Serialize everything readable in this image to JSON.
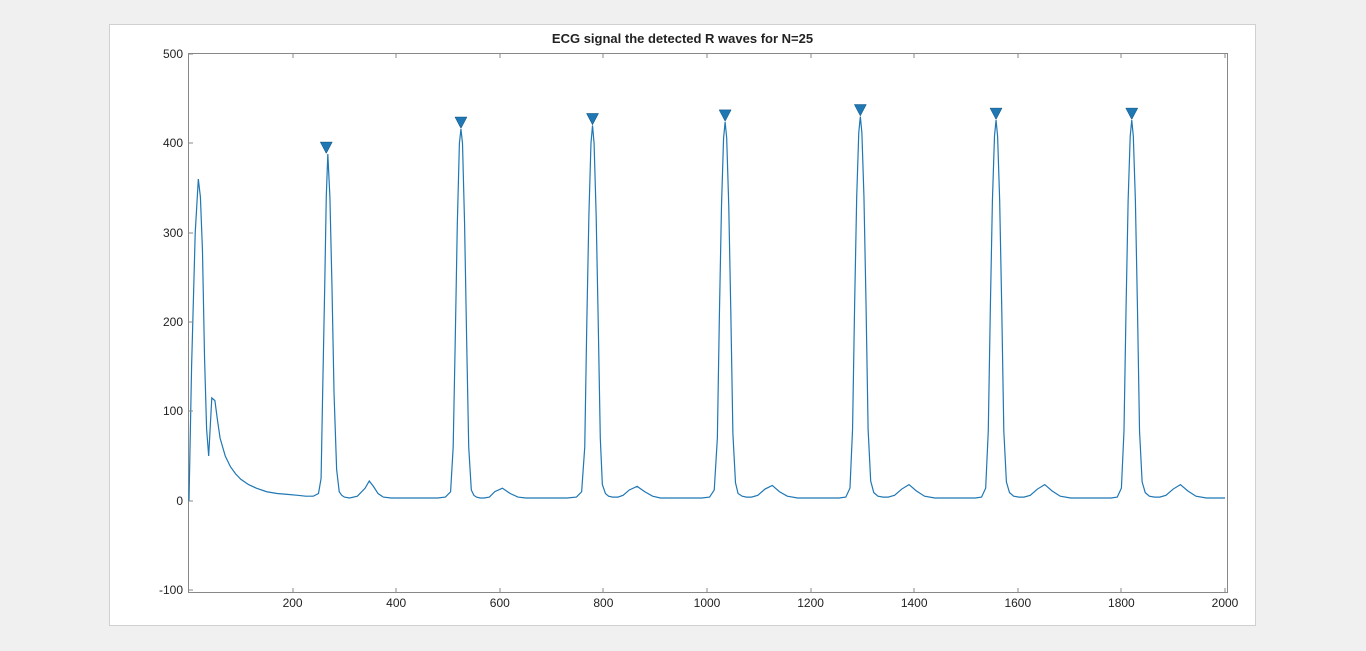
{
  "chart_data": {
    "type": "line",
    "title": "ECG signal the detected R waves for N=25",
    "xlabel": "",
    "ylabel": "",
    "xlim": [
      0,
      2000
    ],
    "ylim": [
      -100,
      500
    ],
    "xticks": [
      200,
      400,
      600,
      800,
      1000,
      1200,
      1400,
      1600,
      1800,
      2000
    ],
    "yticks": [
      -100,
      0,
      100,
      200,
      300,
      400,
      500
    ],
    "series": [
      {
        "name": "ecg",
        "x": [
          0,
          5,
          12,
          18,
          22,
          26,
          30,
          34,
          38,
          44,
          50,
          55,
          60,
          70,
          80,
          90,
          100,
          115,
          130,
          150,
          170,
          190,
          210,
          225,
          240,
          250,
          255,
          258,
          262,
          265,
          268,
          272,
          276,
          280,
          285,
          290,
          295,
          300,
          310,
          325,
          340,
          348,
          356,
          365,
          375,
          390,
          405,
          420,
          440,
          460,
          480,
          495,
          505,
          510,
          514,
          518,
          522,
          525,
          528,
          532,
          536,
          540,
          545,
          550,
          555,
          562,
          570,
          580,
          590,
          605,
          620,
          635,
          650,
          670,
          690,
          710,
          730,
          748,
          758,
          764,
          768,
          772,
          776,
          779,
          782,
          786,
          790,
          794,
          798,
          804,
          810,
          818,
          828,
          838,
          850,
          865,
          880,
          895,
          910,
          930,
          950,
          970,
          990,
          1005,
          1014,
          1020,
          1024,
          1028,
          1032,
          1035,
          1038,
          1042,
          1046,
          1050,
          1055,
          1060,
          1068,
          1076,
          1086,
          1098,
          1112,
          1126,
          1140,
          1155,
          1175,
          1195,
          1215,
          1235,
          1255,
          1268,
          1276,
          1281,
          1285,
          1289,
          1293,
          1296,
          1299,
          1303,
          1307,
          1311,
          1316,
          1322,
          1330,
          1340,
          1350,
          1362,
          1376,
          1390,
          1404,
          1420,
          1440,
          1460,
          1480,
          1500,
          1518,
          1530,
          1538,
          1543,
          1547,
          1551,
          1555,
          1558,
          1561,
          1565,
          1569,
          1573,
          1578,
          1584,
          1592,
          1602,
          1612,
          1624,
          1638,
          1652,
          1666,
          1682,
          1702,
          1722,
          1742,
          1762,
          1780,
          1792,
          1800,
          1805,
          1809,
          1813,
          1817,
          1820,
          1823,
          1827,
          1831,
          1835,
          1840,
          1846,
          1854,
          1864,
          1874,
          1886,
          1900,
          1914,
          1928,
          1944,
          1964,
          1984,
          2000
        ],
        "values": [
          0,
          150,
          300,
          360,
          340,
          280,
          160,
          80,
          50,
          115,
          112,
          90,
          70,
          50,
          38,
          30,
          24,
          18,
          14,
          10,
          8,
          7,
          6,
          5,
          5,
          8,
          25,
          120,
          240,
          340,
          388,
          340,
          240,
          120,
          35,
          10,
          6,
          4,
          3,
          5,
          14,
          22,
          16,
          8,
          4,
          3,
          3,
          3,
          3,
          3,
          3,
          4,
          10,
          60,
          180,
          310,
          400,
          416,
          400,
          310,
          180,
          60,
          12,
          6,
          4,
          3,
          3,
          4,
          10,
          14,
          8,
          4,
          3,
          3,
          3,
          3,
          3,
          4,
          10,
          60,
          200,
          320,
          400,
          420,
          400,
          320,
          200,
          70,
          18,
          8,
          5,
          4,
          4,
          6,
          12,
          16,
          10,
          5,
          3,
          3,
          3,
          3,
          3,
          4,
          12,
          70,
          210,
          330,
          406,
          424,
          406,
          330,
          210,
          75,
          20,
          8,
          5,
          4,
          4,
          6,
          13,
          17,
          10,
          5,
          3,
          3,
          3,
          3,
          3,
          4,
          14,
          80,
          220,
          340,
          412,
          430,
          412,
          340,
          220,
          80,
          22,
          9,
          5,
          4,
          4,
          6,
          13,
          18,
          11,
          5,
          3,
          3,
          3,
          3,
          3,
          4,
          14,
          78,
          216,
          336,
          408,
          426,
          408,
          336,
          216,
          78,
          21,
          9,
          5,
          4,
          4,
          6,
          13,
          18,
          11,
          5,
          3,
          3,
          3,
          3,
          3,
          4,
          14,
          78,
          216,
          336,
          408,
          426,
          408,
          336,
          216,
          78,
          21,
          9,
          5,
          4,
          4,
          6,
          13,
          18,
          11,
          5,
          3,
          3,
          3
        ]
      }
    ],
    "markers": {
      "name": "detected-R-waves",
      "symbol": "triangle-down",
      "x": [
        265,
        525,
        779,
        1035,
        1296,
        1558,
        1820
      ],
      "values": [
        388,
        416,
        420,
        424,
        430,
        426,
        426
      ]
    }
  }
}
